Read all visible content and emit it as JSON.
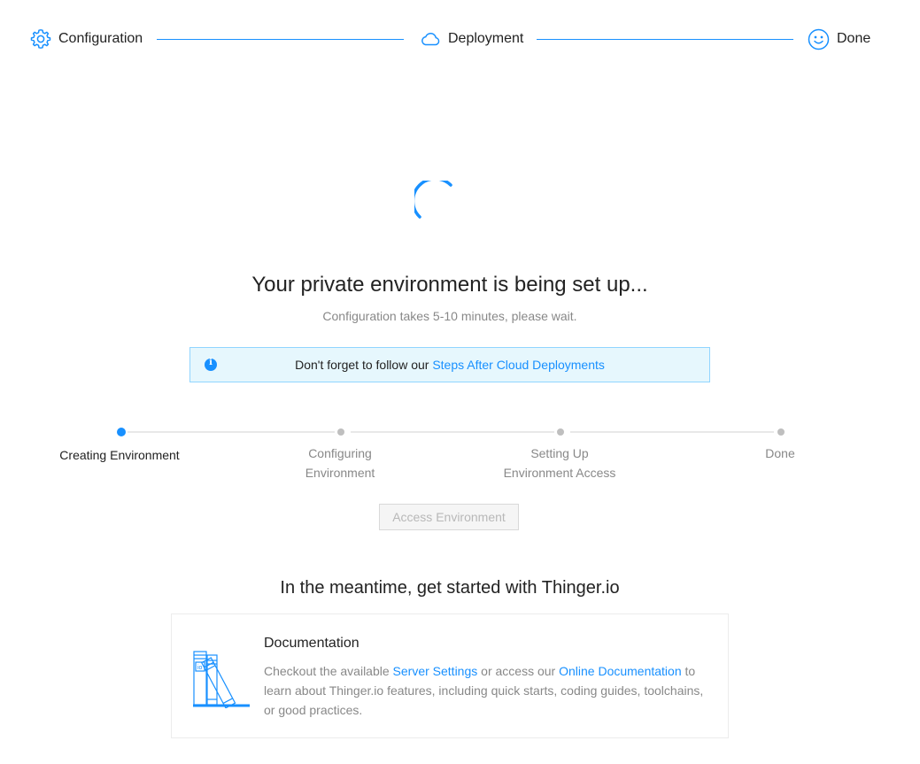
{
  "wizard": {
    "steps": [
      {
        "label": "Configuration",
        "icon": "gear-icon"
      },
      {
        "label": "Deployment",
        "icon": "cloud-icon"
      },
      {
        "label": "Done",
        "icon": "smile-icon"
      }
    ]
  },
  "status": {
    "title": "Your private environment is being set up...",
    "subtitle": "Configuration takes 5-10 minutes, please wait."
  },
  "notice": {
    "icon": "info-icon",
    "text": "Don't forget to follow our ",
    "link": "Steps After Cloud Deployments"
  },
  "progress": {
    "steps": [
      {
        "line1": "Creating Environment",
        "line2": "",
        "state": "active"
      },
      {
        "line1": "Configuring",
        "line2": "Environment",
        "state": "pending"
      },
      {
        "line1": "Setting Up",
        "line2": "Environment Access",
        "state": "pending"
      },
      {
        "line1": "Done",
        "line2": "",
        "state": "pending"
      }
    ]
  },
  "access_button": {
    "label": "Access Environment",
    "disabled": true
  },
  "meantime": {
    "title": "In the meantime, get started with Thinger.io"
  },
  "documentation": {
    "title": "Documentation",
    "icon": "books-icon",
    "text_1": "Checkout the available ",
    "link_1": "Server Settings",
    "text_2": " or access our ",
    "link_2": "Online Documentation",
    "text_3": " to learn about Thinger.io features, including quick starts, coding guides, toolchains, or good practices."
  },
  "colors": {
    "accent": "#1890ff",
    "info_bg": "#e6f7fd",
    "muted_text": "#888888"
  }
}
